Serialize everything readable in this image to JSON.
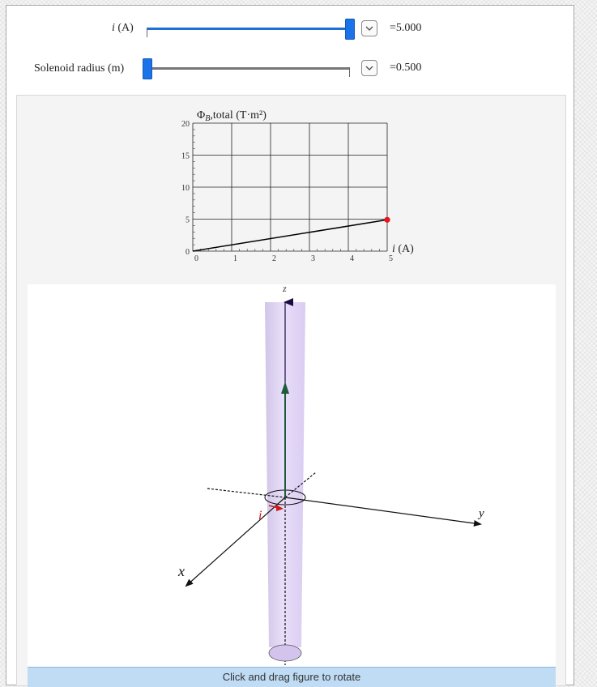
{
  "controls": {
    "current": {
      "label_var": "i",
      "label_unit": "(A)",
      "readout": "=5.000",
      "value": 5.0,
      "min": 0,
      "max": 5
    },
    "radius": {
      "label": "Solenoid radius (m)",
      "readout": "=0.500",
      "value": 0.5,
      "min": 0.5,
      "max": 5
    }
  },
  "chart_data": {
    "type": "line",
    "title": "ΦB,total (T·m²)",
    "title_symbol": "Φ",
    "title_sub": "B",
    "title_rest": ",total (T·m²)",
    "xlabel": "i (A)",
    "xlabel_var": "i",
    "xlabel_unit": "(A)",
    "xlim": [
      0,
      5
    ],
    "ylim": [
      0,
      20
    ],
    "xticks": [
      "0",
      "1",
      "2",
      "3",
      "4",
      "5"
    ],
    "yticks": [
      "0",
      "5",
      "10",
      "15",
      "20"
    ],
    "grid": true,
    "series": [
      {
        "x": [
          0,
          5
        ],
        "y": [
          0,
          4.9
        ]
      }
    ],
    "current_point": {
      "x": 5,
      "y": 4.9,
      "color": "#e8141c"
    }
  },
  "scene": {
    "axis_labels": {
      "x": "x",
      "y": "y",
      "z": "z"
    },
    "current_label": "i",
    "colors": {
      "solenoid": "#d9c8f2",
      "flux_arrow": "#1f5a3a",
      "current_arrow": "#d01818"
    }
  },
  "footer": {
    "text": "Click and drag figure to rotate"
  }
}
